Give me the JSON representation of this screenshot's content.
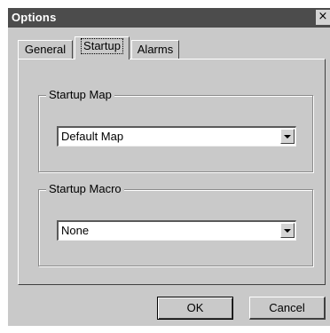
{
  "window": {
    "title": "Options",
    "close_glyph": "×"
  },
  "tabs": [
    {
      "label": "General",
      "active": false
    },
    {
      "label": "Startup",
      "active": true
    },
    {
      "label": "Alarms",
      "active": false
    }
  ],
  "startup_map": {
    "legend": "Startup Map",
    "selected": "Default Map"
  },
  "startup_macro": {
    "legend": "Startup Macro",
    "selected": "None"
  },
  "buttons": {
    "ok_label": "OK",
    "cancel_label": "Cancel"
  },
  "colors": {
    "titlebar": "#4c4c4c",
    "dialog_face": "#c9c9c9"
  }
}
